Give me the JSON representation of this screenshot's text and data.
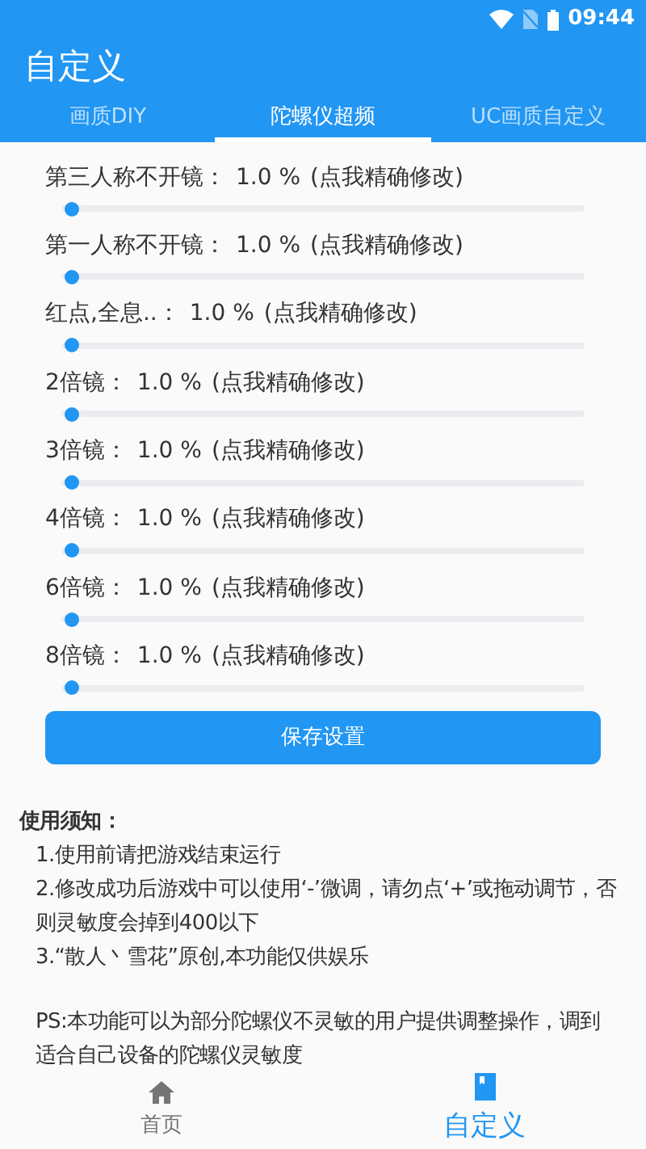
{
  "status_bar": {
    "time": "09:44"
  },
  "app_bar": {
    "title": "自定义"
  },
  "tabs": [
    {
      "label": "画质DIY",
      "selected": false
    },
    {
      "label": "陀螺仪超频",
      "selected": true
    },
    {
      "label": "UC画质自定义",
      "selected": false
    }
  ],
  "settings": [
    {
      "label": "第三人称不开镜：",
      "value": "1.0 %",
      "hint": "(点我精确修改)",
      "level": 0.01
    },
    {
      "label": "第一人称不开镜：",
      "value": "1.0 %",
      "hint": "(点我精确修改)",
      "level": 0.01
    },
    {
      "label": "红点,全息..：",
      "value": "1.0 %",
      "hint": "(点我精确修改)",
      "level": 0.01
    },
    {
      "label": "2倍镜：",
      "value": "1.0 %",
      "hint": "(点我精确修改)",
      "level": 0.01
    },
    {
      "label": "3倍镜：",
      "value": "1.0 %",
      "hint": "(点我精确修改)",
      "level": 0.01
    },
    {
      "label": "4倍镜：",
      "value": "1.0 %",
      "hint": "(点我精确修改)",
      "level": 0.01
    },
    {
      "label": "6倍镜：",
      "value": "1.0 %",
      "hint": "(点我精确修改)",
      "level": 0.01
    },
    {
      "label": "8倍镜：",
      "value": "1.0 %",
      "hint": "(点我精确修改)",
      "level": 0.01
    }
  ],
  "save_button": "保存设置",
  "notes": {
    "title": "使用须知：",
    "items": [
      "1.使用前请把游戏结束运行",
      "2.修改成功后游戏中可以使用‘-’微调，请勿点‘+’或拖动调节，否则灵敏度会掉到400以下",
      "3.“散人丶雪花”原创,本功能仅供娱乐"
    ],
    "ps": "PS:本功能可以为部分陀螺仪不灵敏的用户提供调整操作，调到适合自己设备的陀螺仪灵敏度"
  },
  "bottom_nav": [
    {
      "label": "首页",
      "kind": "home",
      "selected": false
    },
    {
      "label": "自定义",
      "kind": "book",
      "selected": true
    }
  ]
}
